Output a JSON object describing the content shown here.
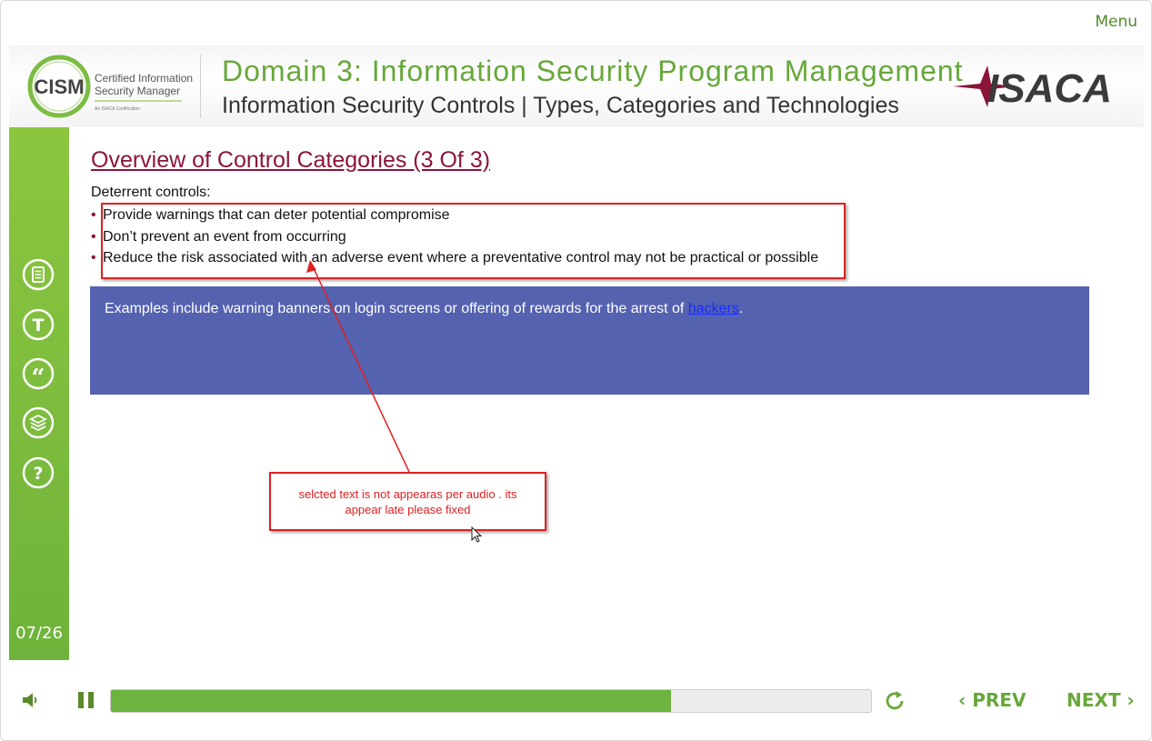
{
  "app": {
    "menu_label": "Menu"
  },
  "header": {
    "logo_acronym": "CISM",
    "logo_line1": "Certified Information",
    "logo_line2": "Security Manager",
    "logo_tagline": "An ISACA Certification",
    "domain_title": "Domain 3: Information Security Program Management",
    "subtitle": "Information Security Controls | Types, Categories and Technologies",
    "brand_logo": "ISACA"
  },
  "sidebar": {
    "icons": [
      "notes-icon",
      "transcript-icon",
      "quote-icon",
      "layers-icon",
      "help-icon"
    ],
    "icon_glyphs": [
      "",
      "T",
      "“",
      "",
      "?"
    ],
    "counter": "07/26"
  },
  "slide": {
    "title": "Overview of Control Categories (3 Of 3)",
    "intro": "Deterrent controls:",
    "bullets": [
      "Provide warnings that can deter potential compromise",
      "Don’t prevent an event from occurring",
      "Reduce the risk associated with an adverse event where a preventative control may not be practical or possible"
    ],
    "example_text": "Examples include warning banners on login screens or offering of rewards for the arrest of ",
    "example_link": "hackers",
    "example_end": "."
  },
  "annotation": {
    "comment_line1": "selcted text is not appearas per audio . its",
    "comment_line2": "appear late please fixed"
  },
  "player": {
    "progress_fraction": 0.737,
    "prev_label": "PREV",
    "next_label": "NEXT"
  },
  "colors": {
    "accent_green": "#67a83a",
    "sidebar_green": "#7dbd3f",
    "title_maroon": "#8a1538",
    "box_blue": "#5462b0",
    "annotation_red": "#e02020"
  }
}
